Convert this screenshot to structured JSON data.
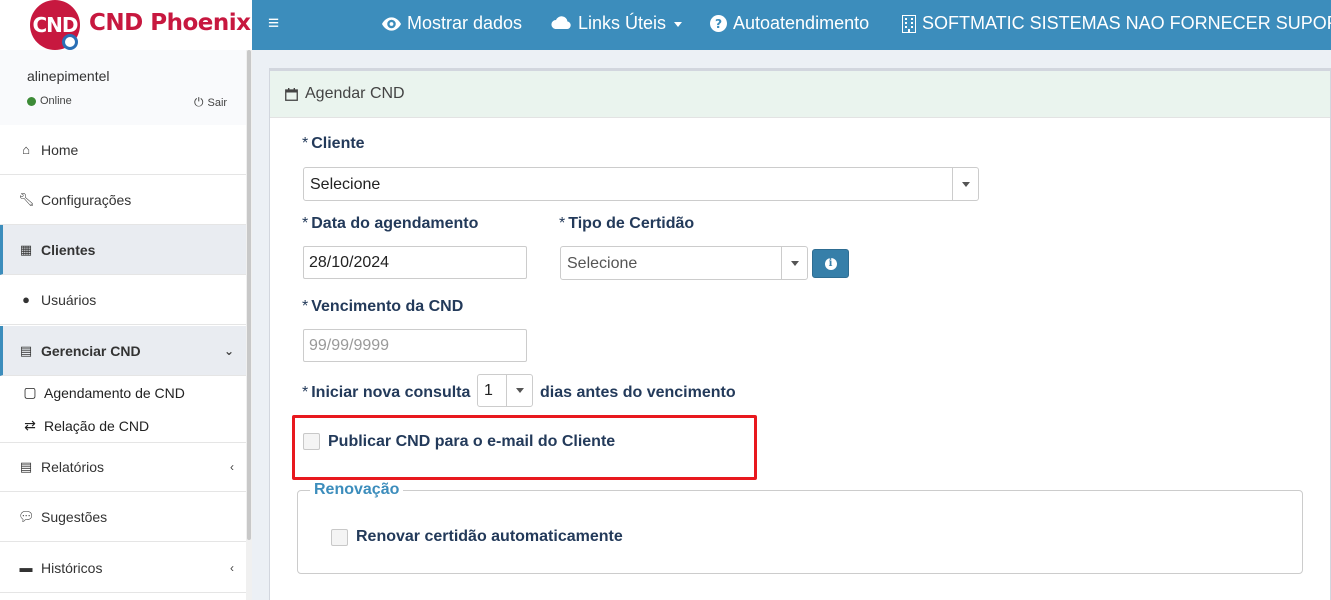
{
  "brand": {
    "logo_badge": "CND",
    "name": "CND Phoenix"
  },
  "topbar": {
    "menu_icon": "hamburger-icon",
    "show_data": "Mostrar dados",
    "links": "Links Úteis",
    "self_service": "Autoatendimento",
    "company": "SOFTMATIC SISTEMAS NAO FORNECER SUPORTE"
  },
  "user": {
    "name": "alinepimentel",
    "status": "Online",
    "logout": "Sair"
  },
  "sidebar": {
    "items": [
      {
        "label": "Home",
        "icon": "home-icon"
      },
      {
        "label": "Configurações",
        "icon": "wrench-icon"
      },
      {
        "label": "Clientes",
        "icon": "building-icon"
      },
      {
        "label": "Usuários",
        "icon": "user-icon"
      },
      {
        "label": "Gerenciar CND",
        "icon": "calendar-icon"
      },
      {
        "label": "Relatórios",
        "icon": "file-icon"
      },
      {
        "label": "Sugestões",
        "icon": "comments-icon"
      },
      {
        "label": "Históricos",
        "icon": "archive-icon"
      }
    ],
    "subitems": [
      {
        "label": "Agendamento de CND",
        "icon": "calendar-icon"
      },
      {
        "label": "Relação de CND",
        "icon": "exchange-icon"
      }
    ]
  },
  "form": {
    "title": "Agendar CND",
    "required_mark": "*",
    "client_label": "Cliente",
    "client_value": "Selecione",
    "date_label": "Data do agendamento",
    "date_value": "28/10/2024",
    "cert_type_label": "Tipo de Certidão",
    "cert_type_value": "Selecione",
    "due_label": "Vencimento da CND",
    "due_placeholder": "99/99/9999",
    "new_query_label": "Iniciar nova consulta",
    "new_query_value": "1",
    "new_query_suffix": "dias antes do vencimento",
    "publish_label": "Publicar CND para o e-mail do Cliente",
    "renewal_legend": "Renovação",
    "renew_label": "Renovar certidão automaticamente"
  },
  "colors": {
    "accent": "#3c8dbc",
    "brand": "#c7183f",
    "highlight": "#e8181e"
  }
}
